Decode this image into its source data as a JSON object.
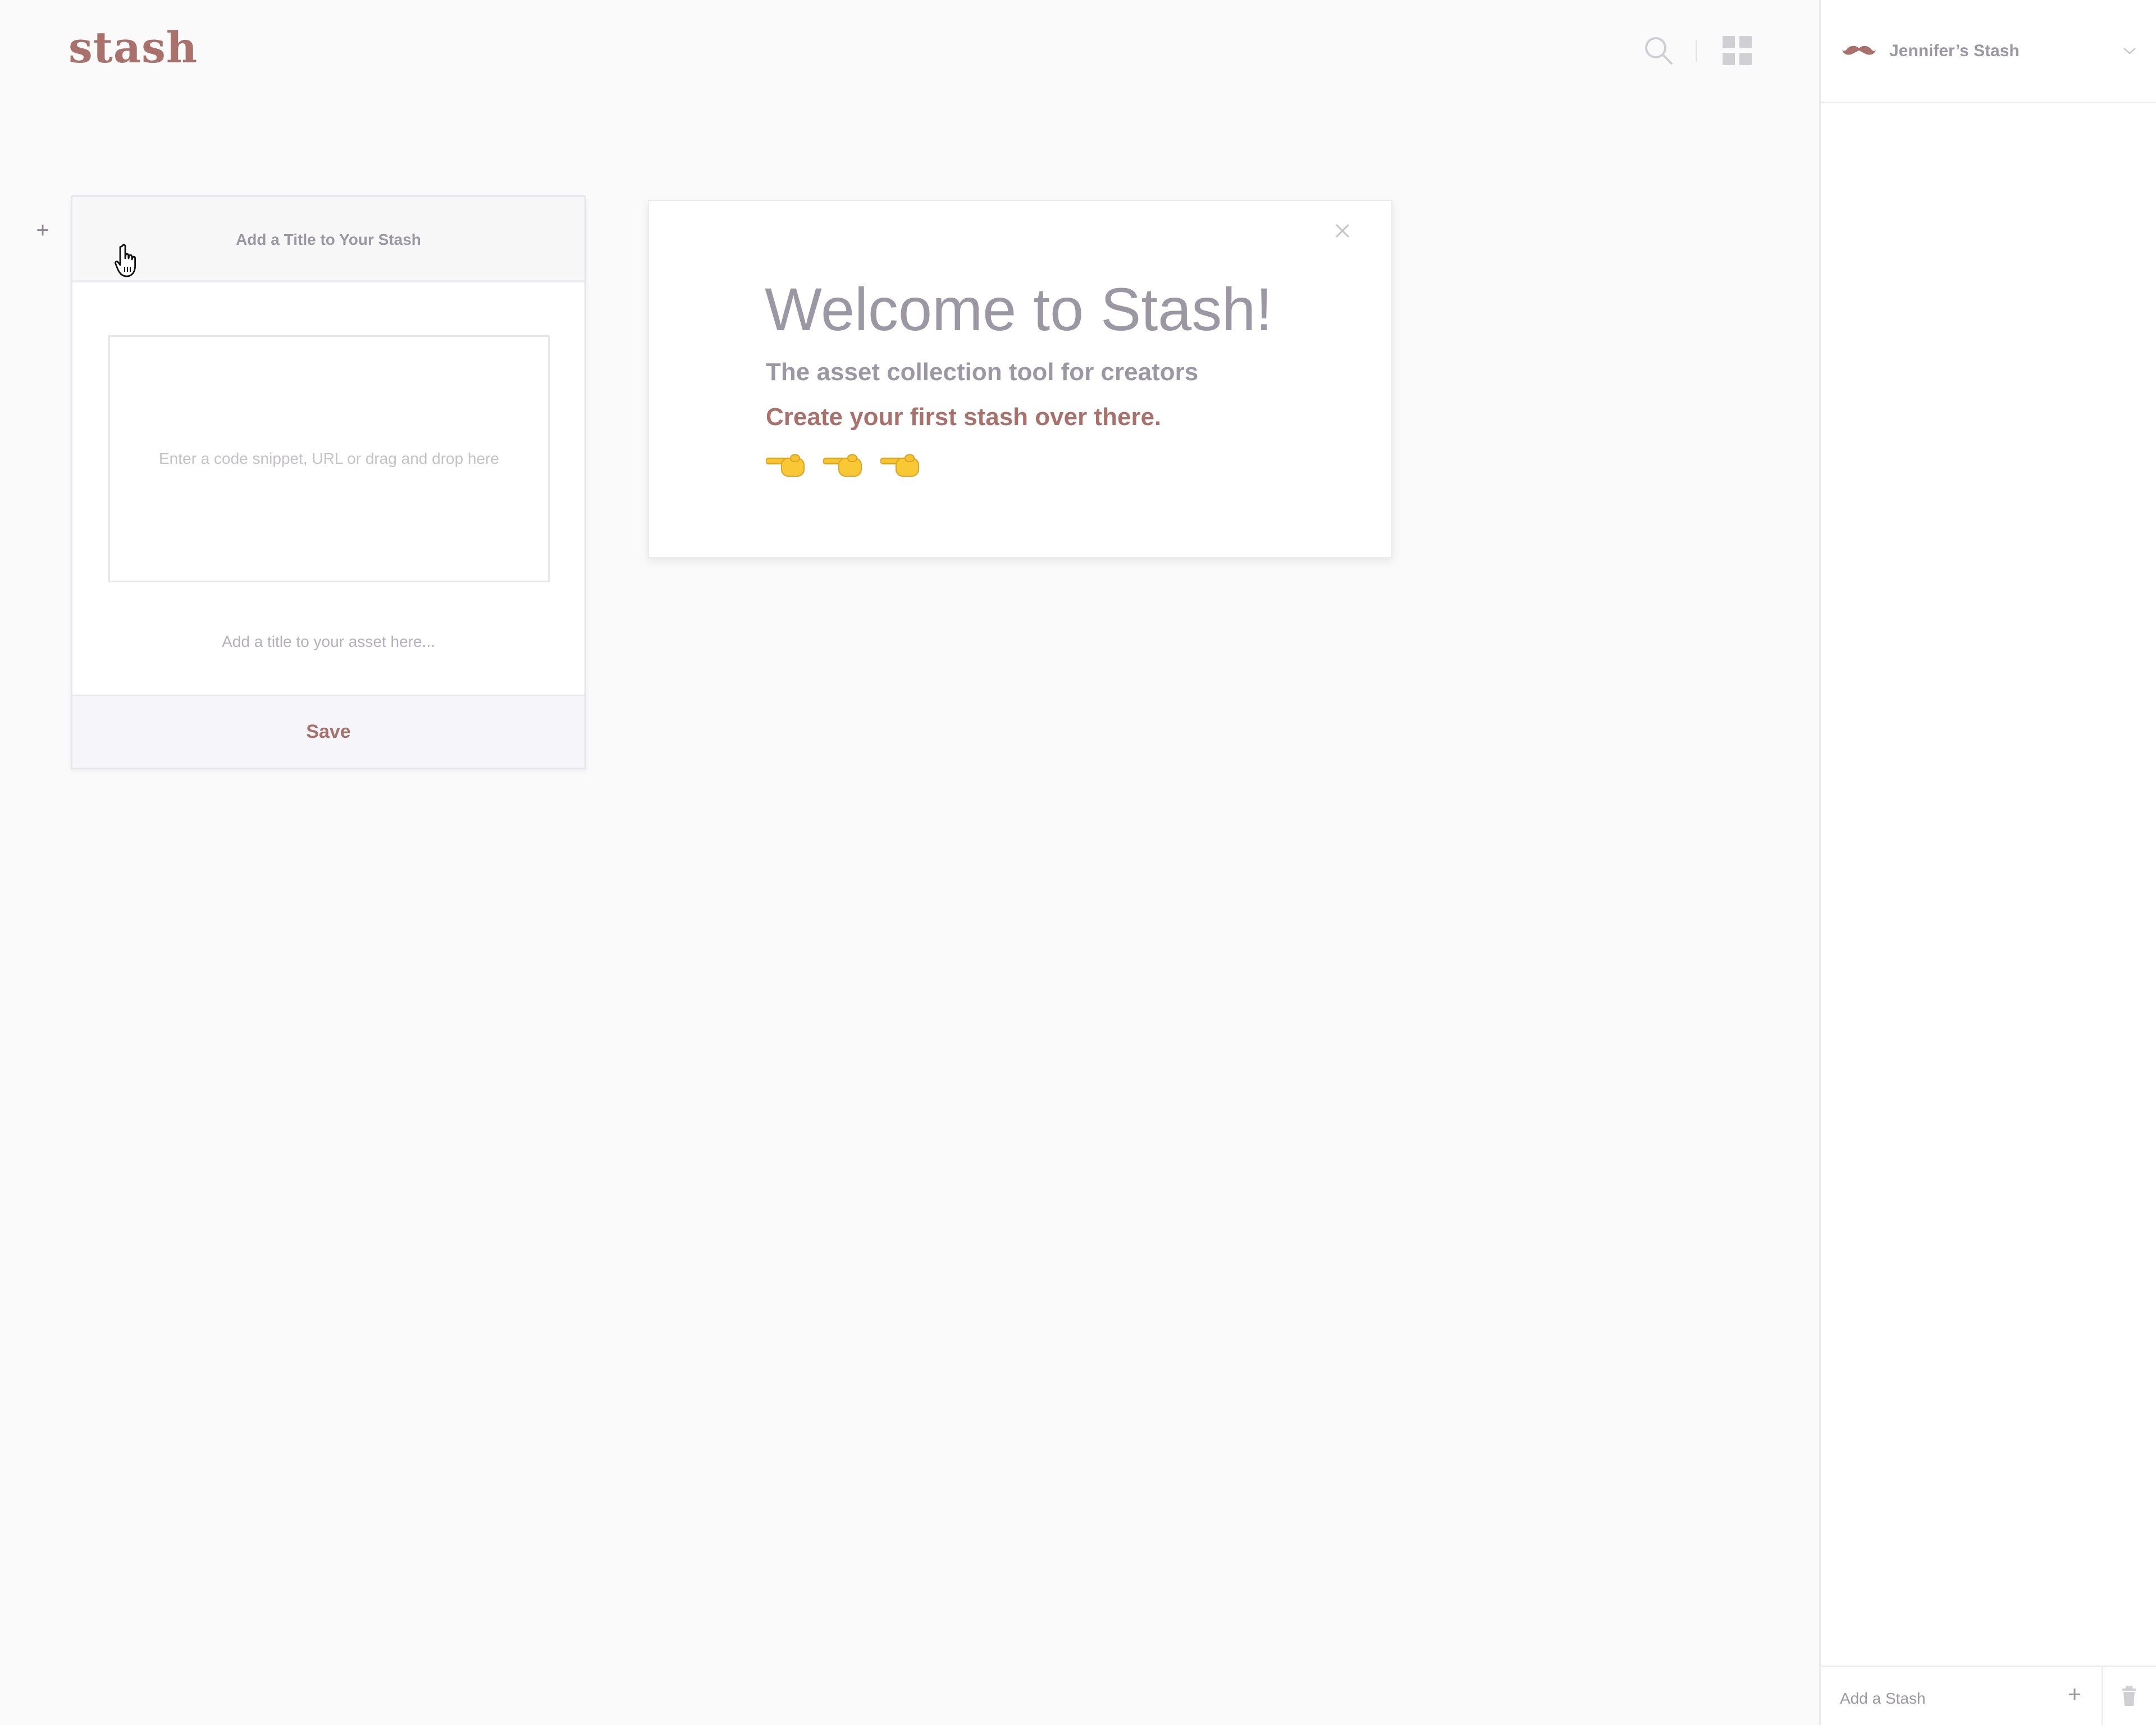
{
  "app": {
    "logo": "stash"
  },
  "topbar": {
    "search_icon": "search-icon",
    "grid_icon": "grid-view-icon"
  },
  "stash_card": {
    "add_icon": "plus-icon",
    "title_placeholder": "Add a Title to Your Stash",
    "dropzone_placeholder": "Enter a code snippet, URL or drag and drop here",
    "asset_title_placeholder": "Add a title to your asset here...",
    "save_label": "Save"
  },
  "welcome_modal": {
    "heading": "Welcome to Stash!",
    "tagline": "The asset collection tool for creators",
    "cta": "Create your first stash over there.",
    "pointer_icons": [
      "pointing-right-hand-icon",
      "pointing-right-hand-icon",
      "pointing-right-hand-icon"
    ],
    "close_icon": "close-icon"
  },
  "sidebar": {
    "avatar_icon": "mustache-icon",
    "stash_name": "Jennifer’s Stash",
    "chevron_icon": "chevron-down-icon",
    "add_stash_label": "Add a Stash",
    "add_icon": "plus-icon",
    "trash_icon": "trash-icon"
  },
  "colors": {
    "brand": "#a8716c",
    "text_muted": "#9b97a3",
    "background": "#fafafa",
    "border": "#ececef"
  }
}
